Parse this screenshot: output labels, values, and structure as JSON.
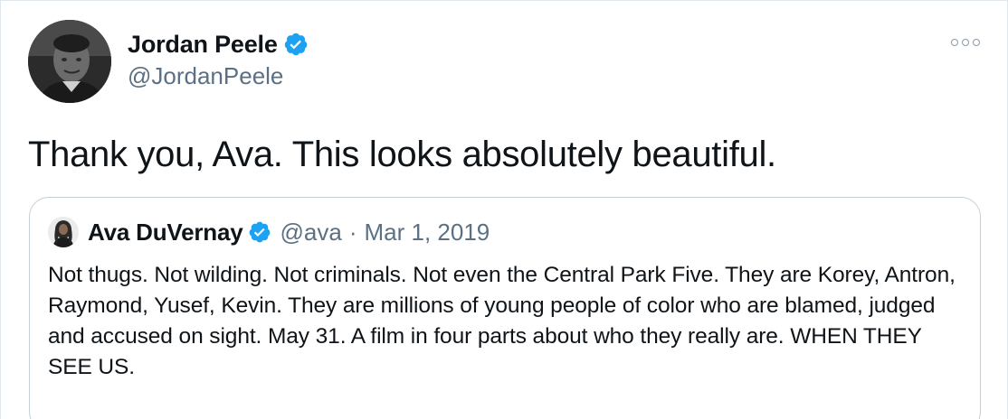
{
  "tweet": {
    "author": {
      "display_name": "Jordan Peele",
      "handle": "@JordanPeele",
      "verified": true,
      "avatar_icon": "profile-photo"
    },
    "more_icon": "more-options-icon",
    "text": "Thank you, Ava. This looks absolutely beautiful."
  },
  "quoted_tweet": {
    "author": {
      "display_name": "Ava DuVernay",
      "handle": "@ava",
      "verified": true,
      "avatar_icon": "profile-photo"
    },
    "separator": "·",
    "date": "Mar 1, 2019",
    "text": "Not thugs. Not wilding. Not criminals. Not even the Central Park Five. They are Korey, Antron, Raymond, Yusef, Kevin. They are millions of young people of color who are blamed, judged and accused on sight. May 31. A film in four parts about who they really are. WHEN THEY SEE US."
  },
  "colors": {
    "verified_blue": "#1da1f2",
    "text_primary": "#0f1419",
    "text_secondary": "#5b7083",
    "border": "#c4cfd6"
  }
}
